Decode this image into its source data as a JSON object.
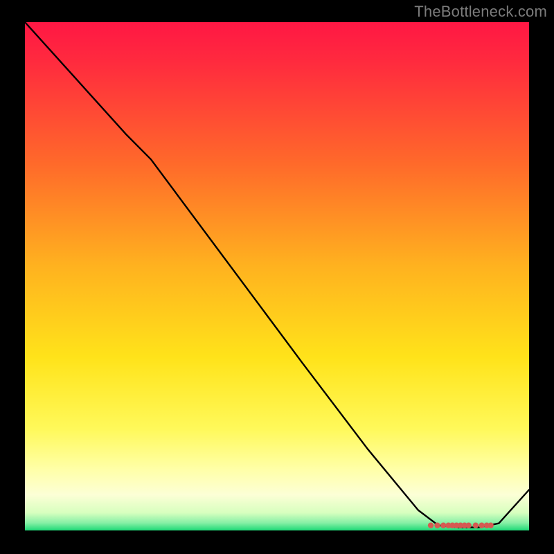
{
  "attribution": "TheBottleneck.com",
  "chart_data": {
    "type": "line",
    "xlabel": "",
    "ylabel": "",
    "xlim": [
      0,
      100
    ],
    "ylim": [
      0,
      100
    ],
    "grid": false,
    "legend": false,
    "gradient_stops": [
      {
        "offset": 0.0,
        "color": "#ff1744"
      },
      {
        "offset": 0.08,
        "color": "#ff2b3e"
      },
      {
        "offset": 0.28,
        "color": "#ff6a2a"
      },
      {
        "offset": 0.48,
        "color": "#ffb21f"
      },
      {
        "offset": 0.66,
        "color": "#ffe31a"
      },
      {
        "offset": 0.8,
        "color": "#fff95a"
      },
      {
        "offset": 0.88,
        "color": "#ffffa8"
      },
      {
        "offset": 0.93,
        "color": "#fcffd6"
      },
      {
        "offset": 0.965,
        "color": "#d8ffbf"
      },
      {
        "offset": 0.985,
        "color": "#87f0a6"
      },
      {
        "offset": 1.0,
        "color": "#1ed977"
      }
    ],
    "series": [
      {
        "name": "bottleneck-curve",
        "x": [
          0,
          10,
          20,
          25,
          40,
          55,
          68,
          78,
          82,
          86,
          90,
          94,
          100
        ],
        "y": [
          100,
          89,
          78,
          73,
          53,
          33,
          16,
          4,
          1,
          0.6,
          0.6,
          1.4,
          8
        ]
      }
    ],
    "marker_cluster": {
      "y": 1.0,
      "x": [
        80.5,
        81.8,
        83.0,
        84.0,
        84.8,
        85.6,
        86.4,
        87.2,
        88.0,
        89.4,
        90.6,
        91.6,
        92.4
      ],
      "color": "#d65a52",
      "radius": 4.2
    }
  }
}
